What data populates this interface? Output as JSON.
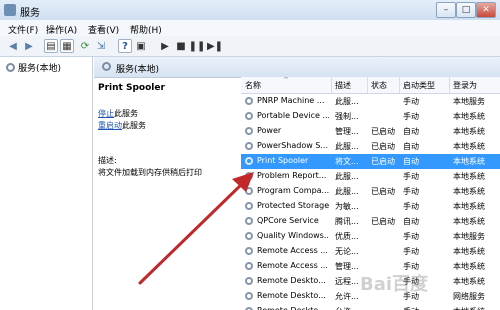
{
  "window": {
    "title": "服务"
  },
  "menu": [
    "文件(F)",
    "操作(A)",
    "查看(V)",
    "帮助(H)"
  ],
  "tree": {
    "root_label": "服务(本地)"
  },
  "panel": {
    "header": "服务(本地)"
  },
  "description": {
    "service_name": "Print Spooler",
    "stop_link": "停止",
    "stop_suffix": "此服务",
    "restart_link": "重启动",
    "restart_suffix": "此服务",
    "label": "描述:",
    "text": "将文件加载到内存供稍后打印"
  },
  "table": {
    "headers": [
      "名称",
      "描述",
      "状态",
      "启动类型",
      "登录为"
    ],
    "rows": [
      {
        "name": "PNRP Machine ...",
        "desc": "此服...",
        "status": "",
        "startup": "手动",
        "logon": "本地服务",
        "selected": false
      },
      {
        "name": "Portable Device ...",
        "desc": "强制...",
        "status": "",
        "startup": "手动",
        "logon": "本地系统",
        "selected": false
      },
      {
        "name": "Power",
        "desc": "管理...",
        "status": "已启动",
        "startup": "自动",
        "logon": "本地系统",
        "selected": false
      },
      {
        "name": "PowerShadow S...",
        "desc": "此服...",
        "status": "已启动",
        "startup": "自动",
        "logon": "本地系统",
        "selected": false
      },
      {
        "name": "Print Spooler",
        "desc": "将文...",
        "status": "已启动",
        "startup": "自动",
        "logon": "本地系统",
        "selected": true
      },
      {
        "name": "Problem Report...",
        "desc": "此服...",
        "status": "",
        "startup": "手动",
        "logon": "本地系统",
        "selected": false
      },
      {
        "name": "Program Compa...",
        "desc": "此服...",
        "status": "已启动",
        "startup": "手动",
        "logon": "本地系统",
        "selected": false
      },
      {
        "name": "Protected Storage",
        "desc": "为敏...",
        "status": "",
        "startup": "手动",
        "logon": "本地系统",
        "selected": false
      },
      {
        "name": "QPCore Service",
        "desc": "腾讯...",
        "status": "已启动",
        "startup": "自动",
        "logon": "本地系统",
        "selected": false
      },
      {
        "name": "Quality Windows...",
        "desc": "优质...",
        "status": "",
        "startup": "手动",
        "logon": "本地服务",
        "selected": false
      },
      {
        "name": "Remote Access ...",
        "desc": "无论...",
        "status": "",
        "startup": "手动",
        "logon": "本地系统",
        "selected": false
      },
      {
        "name": "Remote Access ...",
        "desc": "管理...",
        "status": "",
        "startup": "手动",
        "logon": "本地系统",
        "selected": false
      },
      {
        "name": "Remote Deskto...",
        "desc": "远程...",
        "status": "",
        "startup": "手动",
        "logon": "本地系统",
        "selected": false
      },
      {
        "name": "Remote Deskto...",
        "desc": "允许...",
        "status": "",
        "startup": "手动",
        "logon": "网络服务",
        "selected": false
      },
      {
        "name": "Remote Deskto...",
        "desc": "允许...",
        "status": "",
        "startup": "手动",
        "logon": "本地系统",
        "selected": false
      }
    ]
  },
  "colors": {
    "selection": "#3399ff",
    "link": "#1d54b5",
    "arrow": "#c0282a"
  }
}
